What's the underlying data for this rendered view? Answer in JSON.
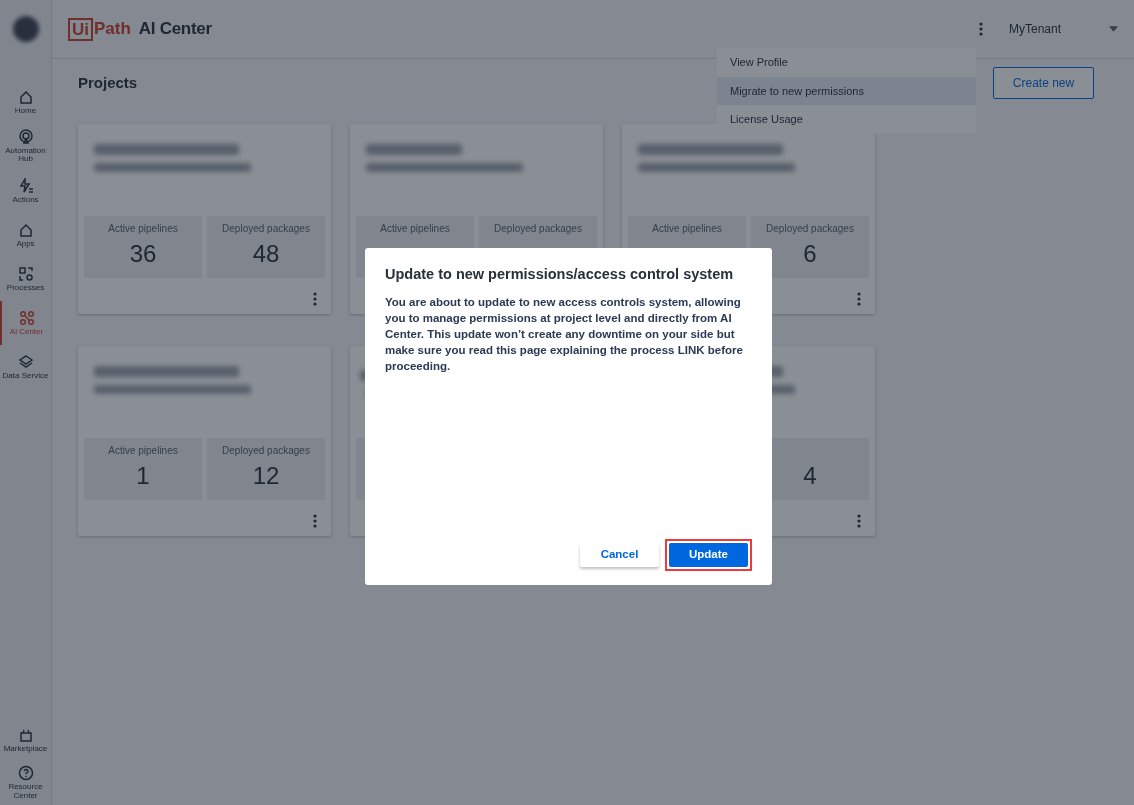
{
  "sidebar": {
    "items": [
      {
        "label": "Home",
        "selected": false
      },
      {
        "label": "Automation Hub",
        "selected": false
      },
      {
        "label": "Actions",
        "selected": false
      },
      {
        "label": "Apps",
        "selected": false
      },
      {
        "label": "Processes",
        "selected": false
      },
      {
        "label": "Ai Center",
        "selected": true
      },
      {
        "label": "Data Service",
        "selected": false
      }
    ],
    "bottom_items": [
      {
        "label": "Marketplace"
      },
      {
        "label": "Resource Center"
      }
    ]
  },
  "header": {
    "logo_boxed": "Ui",
    "logo_rest": "Path",
    "product": "AI Center",
    "tenant": "MyTenant"
  },
  "menu": {
    "items": [
      {
        "label": "View Profile",
        "selected": false
      },
      {
        "label": "Migrate to new permissions",
        "selected": true
      },
      {
        "label": "License Usage",
        "selected": false
      }
    ]
  },
  "page": {
    "title": "Projects",
    "create_button": "Create new"
  },
  "projects": [
    {
      "active_label": "Active pipelines",
      "active_value": "36",
      "deployed_label": "Deployed packages",
      "deployed_value": "48"
    },
    {
      "active_label": "Active pipelines",
      "deployed_label": "Deployed packages"
    },
    {
      "active_label": "Active pipelines",
      "deployed_label": "Deployed packages",
      "deployed_value": "6"
    },
    {
      "active_label": "Active pipelines",
      "active_value": "1",
      "deployed_label": "Deployed packages",
      "deployed_value": "12"
    },
    {
      "kind": "covered"
    },
    {
      "deployed_value": "4"
    }
  ],
  "dialog": {
    "title": "Update to new permissions/access control system",
    "body": "You are about to update to new access controls system, allowing you to manage permissions at project level and directly from AI Center. This update won’t create any downtime on your side but make sure you read this page explaining the process LINK before proceeding.",
    "buttons": [
      {
        "label": "Cancel",
        "kind": "secondary",
        "highlighted": false
      },
      {
        "label": "Update",
        "kind": "primary",
        "highlighted": true
      }
    ]
  }
}
